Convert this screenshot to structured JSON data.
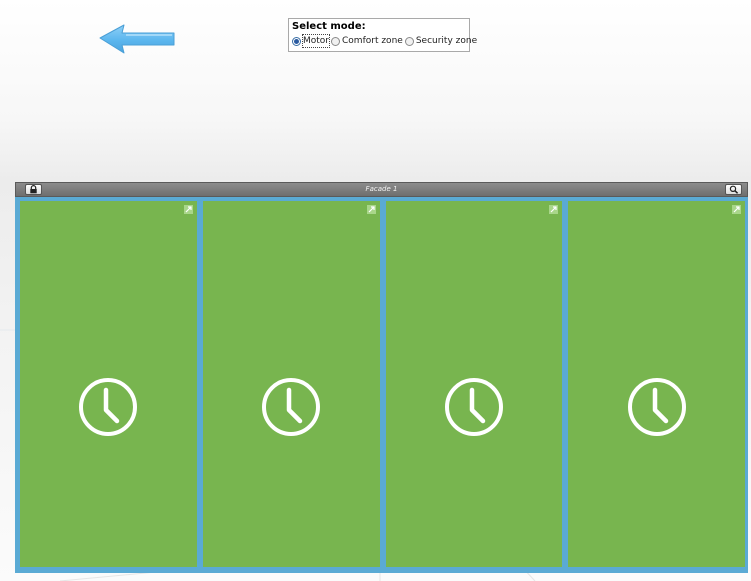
{
  "mode_selector": {
    "title": "Select mode:",
    "options": [
      {
        "label": "Motor",
        "selected": true
      },
      {
        "label": "Comfort zone",
        "selected": false
      },
      {
        "label": "Security zone",
        "selected": false
      }
    ]
  },
  "panel": {
    "title": "Facade 1",
    "lock_icon": "lock-icon",
    "zoom_icon": "zoom-icon",
    "tile_icon": "clock-icon",
    "tile_corner_icon": "expand-icon",
    "tile_color": "#78b54f",
    "frame_color": "#5aaad4"
  },
  "back_icon": "back-arrow-icon"
}
